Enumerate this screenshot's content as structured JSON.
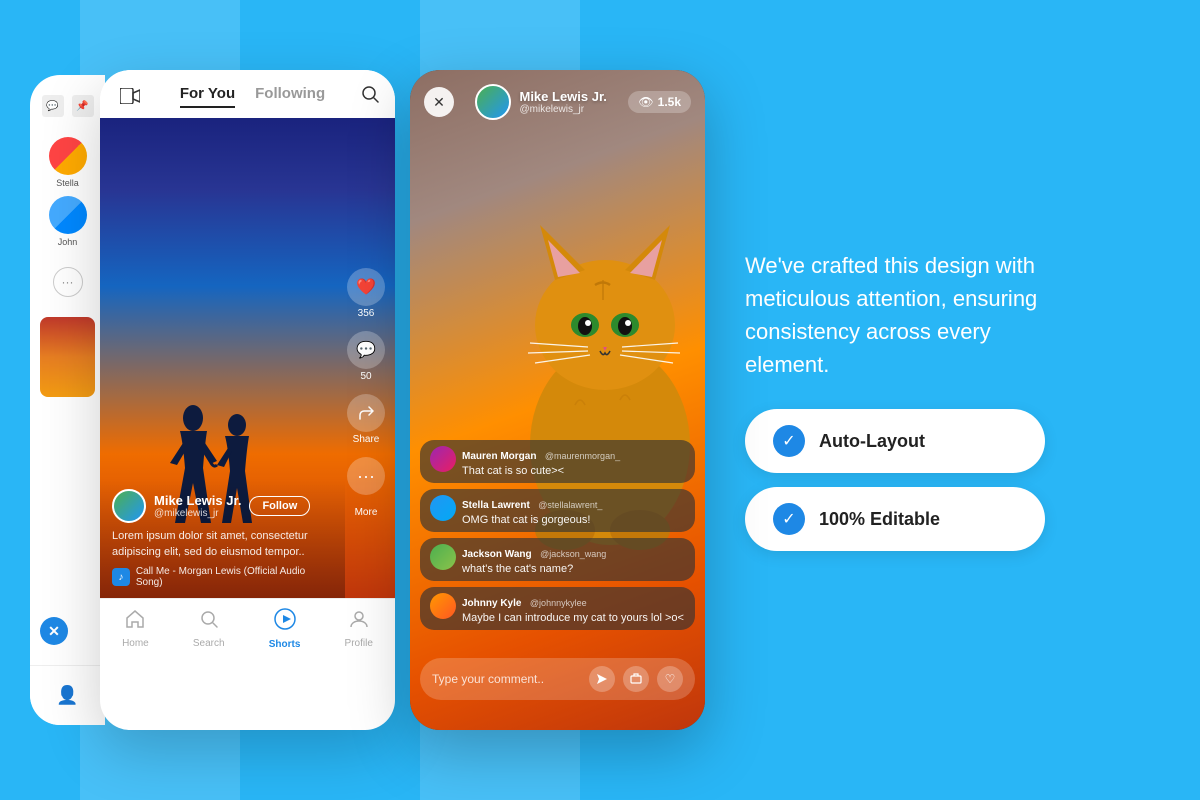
{
  "background": {
    "color": "#29b6f6"
  },
  "phone_left_partial": {
    "stories": [
      {
        "name": "Stella",
        "avatar_colors": [
          "#f44336",
          "#ffab40"
        ]
      },
      {
        "name": "John",
        "avatar_colors": [
          "#42a5f5",
          "#0288d1"
        ]
      }
    ]
  },
  "phone_main": {
    "header": {
      "tabs": [
        "For You",
        "Following"
      ],
      "active_tab": "For You"
    },
    "video": {
      "username": "Mike Lewis Jr.",
      "handle": "@mikelewis_jr",
      "description": "Lorem ipsum dolor sit amet, consectetur adipiscing elit, sed do eiusmod tempor..",
      "audio": "Call Me - Morgan Lewis (Official Audio Song)",
      "like_count": "356",
      "comment_count": "50",
      "share_label": "Share",
      "more_label": "More"
    },
    "nav": {
      "items": [
        {
          "label": "Home",
          "icon": "🏠",
          "active": false
        },
        {
          "label": "Search",
          "icon": "🔍",
          "active": false
        },
        {
          "label": "Shorts",
          "icon": "▶",
          "active": true
        },
        {
          "label": "Profile",
          "icon": "👤",
          "active": false
        }
      ]
    }
  },
  "phone_live": {
    "header": {
      "username": "Mike Lewis Jr.",
      "handle": "@mikelewis_jr",
      "viewer_count": "1.5k"
    },
    "comments": [
      {
        "username": "Mauren Morgan",
        "handle": "@maurenmorgan_",
        "text": "That cat is so cute><"
      },
      {
        "username": "Stella Lawrent",
        "handle": "@stellalawrent_",
        "text": "OMG that cat is gorgeous!"
      },
      {
        "username": "Jackson Wang",
        "handle": "@jackson_wang",
        "text": "what's the cat's name?"
      },
      {
        "username": "Johnny Kyle",
        "handle": "@johnnykylee",
        "text": "Maybe I can introduce my cat to yours lol >o<"
      }
    ],
    "input_placeholder": "Type your comment.."
  },
  "right_content": {
    "description": "We've crafted this design with meticulous attention, ensuring consistency across every element.",
    "buttons": [
      {
        "label": "Auto-Layout",
        "icon": "✓"
      },
      {
        "label": "100% Editable",
        "icon": "✓"
      }
    ]
  }
}
